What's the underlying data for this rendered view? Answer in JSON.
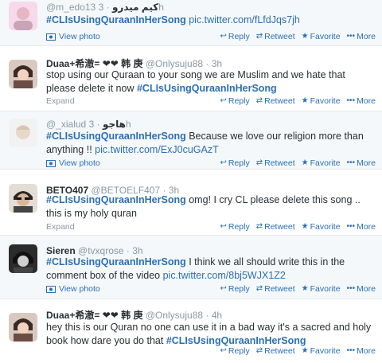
{
  "tweets": [
    {
      "fullname": "كيم ميدرو",
      "handle": "@m_edo13",
      "time": "3h",
      "parts": [
        {
          "t": "tag",
          "v": "#CLIsUsingQuraanInHerSong"
        },
        {
          "t": "text",
          "v": " "
        },
        {
          "t": "link",
          "v": "pic.twitter.com/fLfdJqs7jh"
        }
      ],
      "meta": "View photo"
    },
    {
      "fullname": "Duaa+希澈= ❤❤ 韩 庚",
      "handle": "@Onlysuju88",
      "time": "3h",
      "parts": [
        {
          "t": "text",
          "v": "stop using our Quraan to your song we are Muslim and we hate that please delete it now "
        },
        {
          "t": "tag",
          "v": "#CLIsUsingQuraanInHerSong"
        }
      ],
      "meta": "Expand"
    },
    {
      "fullname": "هاجو",
      "handle": "@_xialud",
      "time": "3h",
      "parts": [
        {
          "t": "tag",
          "v": "#CLIsUsingQuraanInHerSong"
        },
        {
          "t": "text",
          "v": " Because we love our religion more than anything !! "
        },
        {
          "t": "link",
          "v": "pic.twitter.com/ExJ0cuGAzT"
        }
      ],
      "meta": "View photo"
    },
    {
      "fullname": "BETO407",
      "handle": "@BETOELF407",
      "time": "3h",
      "parts": [
        {
          "t": "tag",
          "v": "#CLIsUsingQuraanInHerSong"
        },
        {
          "t": "text",
          "v": "  omg! I cry CL please delete this song .. this is my holy quran"
        }
      ],
      "meta": "Expand"
    },
    {
      "fullname": "Sieren",
      "handle": "@tvxqrose",
      "time": "3h",
      "parts": [
        {
          "t": "tag",
          "v": "#CLIsUsingQuraanInHerSong"
        },
        {
          "t": "text",
          "v": " I think we all should write this in the comment box of the video "
        },
        {
          "t": "link",
          "v": "pic.twitter.com/8bj5WJX1Z2"
        }
      ],
      "meta": "View photo"
    },
    {
      "fullname": "Duaa+希澈= ❤❤ 韩 庚",
      "handle": "@Onlysuju88",
      "time": "4h",
      "parts": [
        {
          "t": "text",
          "v": "hey this is our Quran no one can use it in a bad way it's a sacred and holy book how dare you do that "
        },
        {
          "t": "tag",
          "v": "#CLIsUsingQuraanInHerSong"
        }
      ],
      "meta": ""
    }
  ],
  "actions": {
    "reply": "Reply",
    "retweet": "Retweet",
    "favorite": "Favorite",
    "more": "More"
  },
  "separator": "·",
  "icons": {
    "reply": "reply-arrow-icon",
    "retweet": "retweet-icon",
    "favorite": "star-icon",
    "more": "ellipsis-icon",
    "photo": "photo-icon"
  },
  "colors": {
    "link": "#2a6fb5",
    "muted": "#8899a6",
    "text": "#292f33",
    "alt_bg": "#f5f8fa"
  }
}
